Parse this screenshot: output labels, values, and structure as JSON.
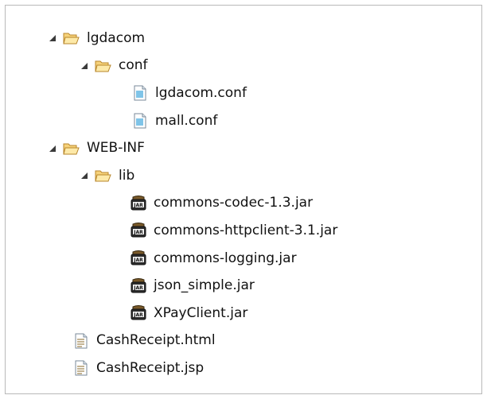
{
  "tree": {
    "items": [
      {
        "label": "lgdacom",
        "icon": "folder-open-icon",
        "expanded": true
      },
      {
        "label": "conf",
        "icon": "folder-open-icon",
        "expanded": true
      },
      {
        "label": "lgdacom.conf",
        "icon": "file-text-icon"
      },
      {
        "label": "mall.conf",
        "icon": "file-text-icon"
      },
      {
        "label": "WEB-INF",
        "icon": "folder-open-icon",
        "expanded": true
      },
      {
        "label": "lib",
        "icon": "folder-open-icon",
        "expanded": true
      },
      {
        "label": "commons-codec-1.3.jar",
        "icon": "jar-icon"
      },
      {
        "label": "commons-httpclient-3.1.jar",
        "icon": "jar-icon"
      },
      {
        "label": "commons-logging.jar",
        "icon": "jar-icon"
      },
      {
        "label": "json_simple.jar",
        "icon": "jar-icon"
      },
      {
        "label": "XPayClient.jar",
        "icon": "jar-icon"
      },
      {
        "label": "CashReceipt.html",
        "icon": "file-document-icon"
      },
      {
        "label": "CashReceipt.jsp",
        "icon": "file-document-icon"
      }
    ]
  },
  "colors": {
    "folder": "#e8b84a",
    "folder_border": "#b8862b",
    "toggle": "#3a3a3a",
    "border": "#b9b9b9"
  }
}
